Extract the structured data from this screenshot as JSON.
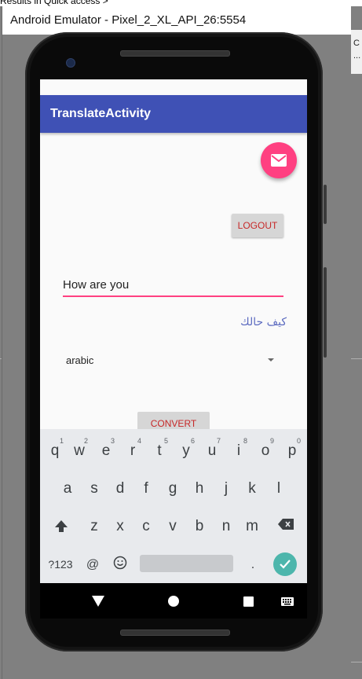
{
  "background": {
    "top_text": "Results in Quick access  >",
    "right_text_line1": "C",
    "right_text_line2": "..."
  },
  "window": {
    "title": "Android Emulator - Pixel_2_XL_API_26:5554"
  },
  "app": {
    "title": "TranslateActivity",
    "logout_label": "LOGOUT",
    "input_value": "How are you",
    "translated_text": "كيف حالك",
    "language_selected": "arabic",
    "convert_label": "CONVERT"
  },
  "keyboard": {
    "row1": [
      {
        "ch": "q",
        "hint": "1"
      },
      {
        "ch": "w",
        "hint": "2"
      },
      {
        "ch": "e",
        "hint": "3"
      },
      {
        "ch": "r",
        "hint": "4"
      },
      {
        "ch": "t",
        "hint": "5"
      },
      {
        "ch": "y",
        "hint": "6"
      },
      {
        "ch": "u",
        "hint": "7"
      },
      {
        "ch": "i",
        "hint": "8"
      },
      {
        "ch": "o",
        "hint": "9"
      },
      {
        "ch": "p",
        "hint": "0"
      }
    ],
    "row2": [
      "a",
      "s",
      "d",
      "f",
      "g",
      "h",
      "j",
      "k",
      "l"
    ],
    "row3": [
      "z",
      "x",
      "c",
      "v",
      "b",
      "n",
      "m"
    ],
    "symbols_label": "?123",
    "at_label": "@",
    "period_label": "."
  },
  "colors": {
    "appbar": "#3f51b5",
    "accent": "#ff4081",
    "button_text": "#c62828",
    "translated_text": "#5c6bc0",
    "enter_key": "#4db6ac"
  }
}
